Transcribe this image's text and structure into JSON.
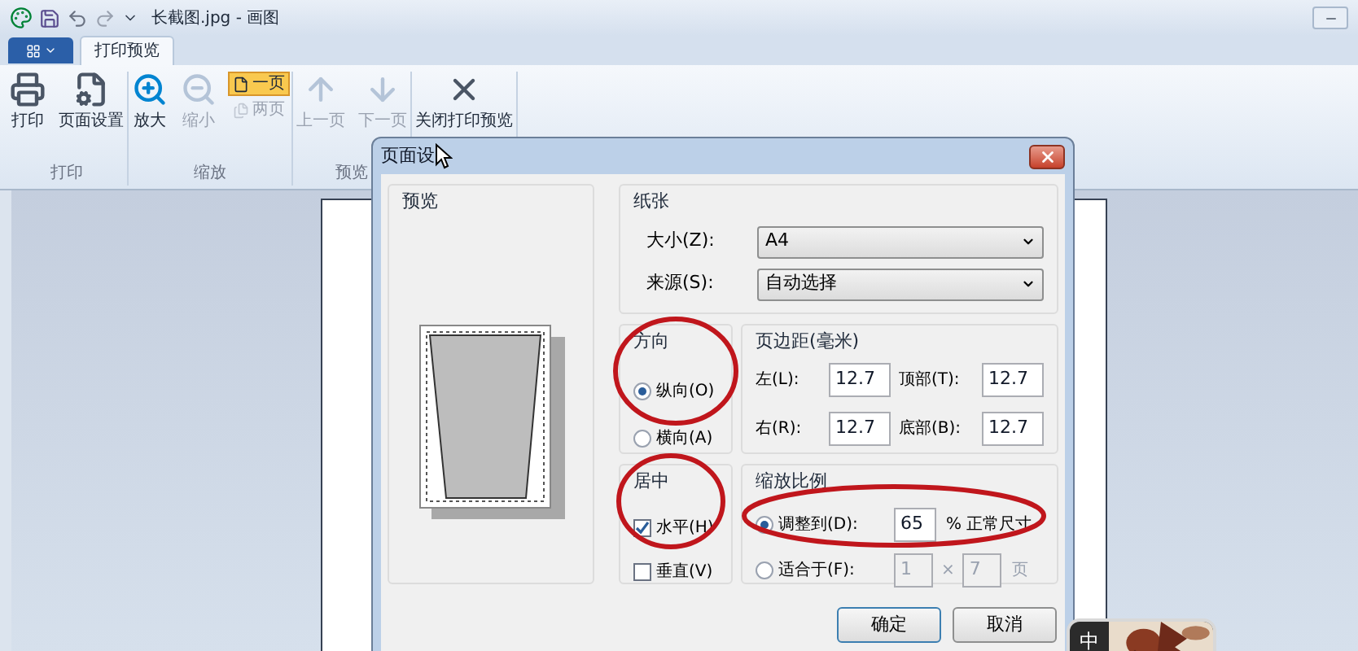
{
  "title_bar": {
    "title": "长截图.jpg - 画图"
  },
  "ribbon_tabs": [
    {
      "label": "打印预览",
      "selected": true
    }
  ],
  "ribbon_groups": [
    {
      "label": "打印",
      "buttons": [
        {
          "kind": "large",
          "label": "打印",
          "disabled": false
        },
        {
          "kind": "large",
          "label": "页面设置",
          "disabled": false
        }
      ]
    },
    {
      "label": "缩放",
      "buttons": [
        {
          "kind": "large",
          "label": "放大",
          "disabled": false
        },
        {
          "kind": "large",
          "label": "缩小",
          "disabled": true
        },
        {
          "kind": "toggle",
          "label": "一页",
          "selected": true,
          "disabled": false
        },
        {
          "kind": "toggle",
          "label": "两页",
          "selected": false,
          "disabled": true
        }
      ]
    },
    {
      "label": "预览",
      "buttons": [
        {
          "kind": "large",
          "label": "上一页",
          "disabled": true
        },
        {
          "kind": "large",
          "label": "下一页",
          "disabled": true
        }
      ]
    },
    {
      "buttons": [
        {
          "kind": "large",
          "label": "关闭打印预览",
          "disabled": false
        }
      ]
    }
  ],
  "dialog": {
    "title": "页面设",
    "preview": {
      "label": "预览"
    },
    "paper": {
      "label": "纸张",
      "fields": [
        {
          "label": "大小(Z):",
          "value": "A4"
        },
        {
          "label": "来源(S):",
          "value": "自动选择"
        }
      ]
    },
    "orientation": {
      "label": "方向",
      "options": [
        {
          "label": "纵向(O)",
          "selected": true
        },
        {
          "label": "横向(A)",
          "selected": false
        }
      ]
    },
    "margins": {
      "label": "页边距(毫米)",
      "fields": [
        {
          "label": "左(L):",
          "value": "12.7"
        },
        {
          "label": "顶部(T):",
          "value": "12.7"
        },
        {
          "label": "右(R):",
          "value": "12.7"
        },
        {
          "label": "底部(B):",
          "value": "12.7"
        }
      ]
    },
    "centering": {
      "label": "居中",
      "options": [
        {
          "label": "水平(H)",
          "checked": true
        },
        {
          "label": "垂直(V)",
          "checked": false
        }
      ]
    },
    "scaling": {
      "label": "缩放比例",
      "options": [
        {
          "kind": "percent",
          "label": "调整到(D):",
          "selected": true,
          "value": "65",
          "suffix": "% 正常尺寸"
        },
        {
          "kind": "fit",
          "label": "适合于(F):",
          "selected": false,
          "wide": "1",
          "separator": "×",
          "tall": "7",
          "suffix": "页"
        }
      ]
    },
    "buttons": [
      {
        "label": "确定",
        "default": true
      },
      {
        "label": "取消",
        "default": false
      }
    ]
  },
  "ime_popup": {
    "label": "中"
  }
}
